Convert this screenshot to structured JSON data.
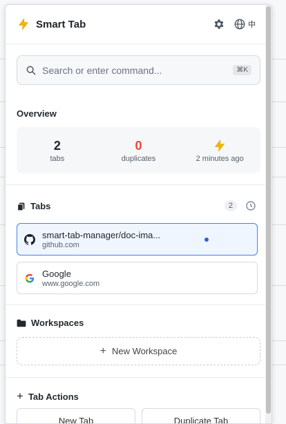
{
  "header": {
    "title": "Smart Tab",
    "lang_label": "中"
  },
  "search": {
    "placeholder": "Search or enter command...",
    "shortcut": "⌘K"
  },
  "overview": {
    "heading": "Overview",
    "tabs": {
      "value": "2",
      "label": "tabs"
    },
    "duplicates": {
      "value": "0",
      "label": "duplicates"
    },
    "last": {
      "label": "2 minutes ago"
    }
  },
  "tabs_section": {
    "heading": "Tabs",
    "count": "2",
    "items": [
      {
        "title": "smart-tab-manager/doc-ima...",
        "url": "github.com",
        "favicon": "github-icon"
      },
      {
        "title": "Google",
        "url": "www.google.com",
        "favicon": "google-icon"
      }
    ]
  },
  "workspaces": {
    "heading": "Workspaces",
    "new_label": "New Workspace"
  },
  "tab_actions": {
    "heading": "Tab Actions",
    "new_tab": "New Tab",
    "duplicate_tab": "Duplicate Tab"
  },
  "colors": {
    "accent": "#2563eb",
    "danger": "#f04438",
    "bolt": "#f5b400"
  }
}
